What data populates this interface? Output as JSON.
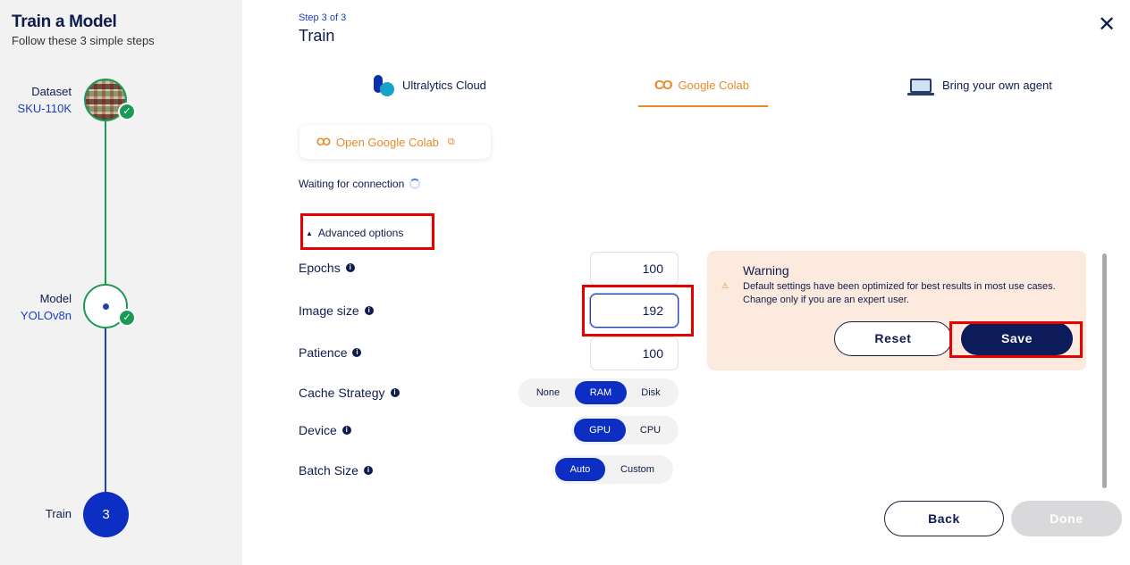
{
  "sidebar": {
    "title": "Train a Model",
    "subtitle": "Follow these 3 simple steps",
    "steps": [
      {
        "name": "Dataset",
        "value": "SKU-110K",
        "status": "done"
      },
      {
        "name": "Model",
        "value": "YOLOv8n",
        "status": "done"
      },
      {
        "name": "Train",
        "value": "",
        "number": "3",
        "status": "current"
      }
    ]
  },
  "header": {
    "step_text": "Step 3 of 3",
    "title": "Train",
    "close_icon": "close-icon"
  },
  "tabs": [
    {
      "label": "Ultralytics Cloud",
      "icon": "ultralytics-icon",
      "active": false
    },
    {
      "label": "Google Colab",
      "icon": "colab-icon",
      "active": true
    },
    {
      "label": "Bring your own agent",
      "icon": "laptop-icon",
      "active": false
    }
  ],
  "colab": {
    "open_label": "Open Google Colab",
    "status": "Waiting for connection"
  },
  "advanced": {
    "toggle_label": "Advanced options",
    "expanded": true,
    "fields": {
      "epochs": {
        "label": "Epochs",
        "value": "100"
      },
      "image_size": {
        "label": "Image size",
        "value": "192"
      },
      "patience": {
        "label": "Patience",
        "value": "100"
      },
      "cache": {
        "label": "Cache Strategy",
        "options": [
          "None",
          "RAM",
          "Disk"
        ],
        "selected": "RAM"
      },
      "device": {
        "label": "Device",
        "options": [
          "GPU",
          "CPU"
        ],
        "selected": "GPU"
      },
      "batch": {
        "label": "Batch Size",
        "options": [
          "Auto",
          "Custom"
        ],
        "selected": "Auto"
      }
    }
  },
  "warning": {
    "title": "Warning",
    "text": "Default settings have been optimized for best results in most use cases. Change only if you are an expert user.",
    "reset_label": "Reset",
    "save_label": "Save"
  },
  "footer": {
    "back_label": "Back",
    "done_label": "Done"
  },
  "colors": {
    "primary": "#0d2ec2",
    "navy": "#0c1c5a",
    "accent_orange": "#e8892a",
    "success_green": "#1b9a55",
    "highlight_red": "#e60000",
    "warning_bg": "#fdeade"
  }
}
